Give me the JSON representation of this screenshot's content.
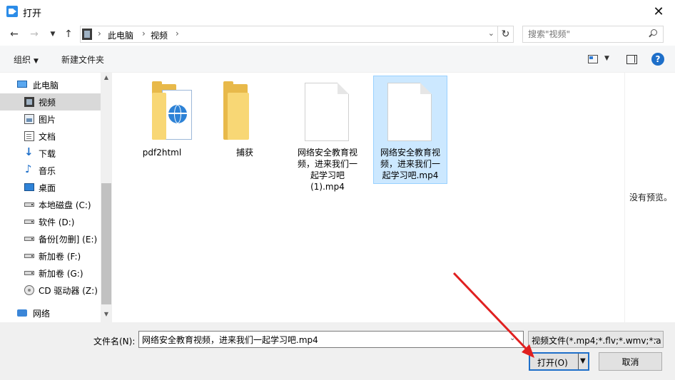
{
  "window": {
    "title": "打开"
  },
  "breadcrumb": [
    "此电脑",
    "视频"
  ],
  "search": {
    "placeholder": "搜索\"视频\""
  },
  "toolbar": {
    "organize": "组织",
    "new_folder": "新建文件夹"
  },
  "sidebar": {
    "items": [
      {
        "label": "此电脑",
        "icon": "pc-icon"
      },
      {
        "label": "视频",
        "icon": "video-folder-icon",
        "selected": true
      },
      {
        "label": "图片",
        "icon": "pictures-icon"
      },
      {
        "label": "文档",
        "icon": "documents-icon"
      },
      {
        "label": "下载",
        "icon": "download-icon"
      },
      {
        "label": "音乐",
        "icon": "music-icon"
      },
      {
        "label": "桌面",
        "icon": "desktop-icon"
      },
      {
        "label": "本地磁盘 (C:)",
        "icon": "drive-icon"
      },
      {
        "label": "软件 (D:)",
        "icon": "drive-icon"
      },
      {
        "label": "备份[勿删] (E:)",
        "icon": "drive-icon"
      },
      {
        "label": "新加卷 (F:)",
        "icon": "drive-icon"
      },
      {
        "label": "新加卷 (G:)",
        "icon": "drive-icon"
      },
      {
        "label": "CD 驱动器 (Z:)",
        "icon": "cd-drive-icon"
      },
      {
        "label": "网络",
        "icon": "network-icon"
      }
    ]
  },
  "files": [
    {
      "name": "pdf2html",
      "type": "folder-html"
    },
    {
      "name": "捕获",
      "type": "folder"
    },
    {
      "name": "网络安全教育视频，进来我们一起学习吧(1).mp4",
      "type": "file"
    },
    {
      "name": "网络安全教育视频，进来我们一起学习吧.mp4",
      "type": "file",
      "selected": true
    }
  ],
  "preview": {
    "text": "没有预览。"
  },
  "bottom": {
    "filename_label": "文件名(N):",
    "filename_value": "网络安全教育视频，进来我们一起学习吧.mp4",
    "filter": "视频文件(*.mp4;*.flv;*.wmv;*.a",
    "open_label": "打开(O)",
    "cancel_label": "取消"
  },
  "colors": {
    "accent": "#1e6fc9",
    "selection": "#cce8ff",
    "folder": "#f8d775"
  }
}
